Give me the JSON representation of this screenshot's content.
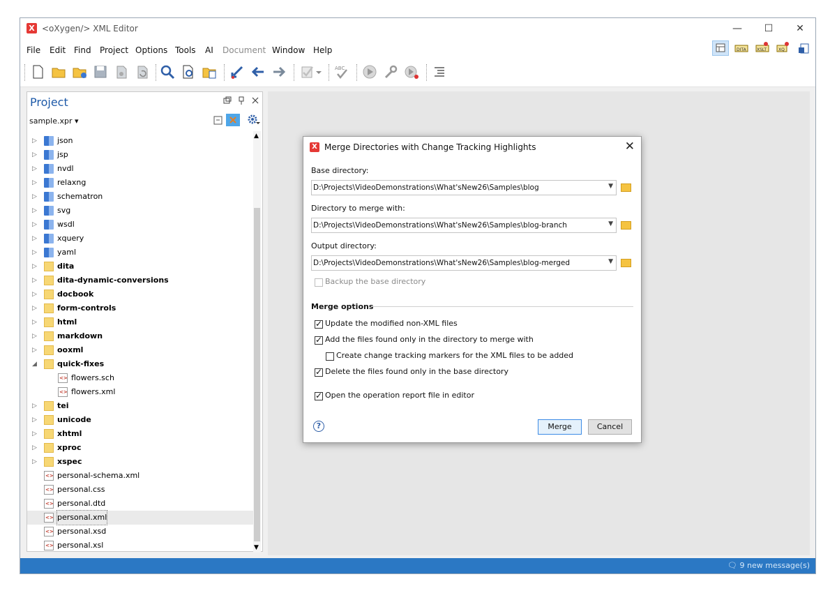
{
  "window": {
    "title": "<oXygen/> XML Editor",
    "minimize": "—",
    "maximize": "☐",
    "close": "✕"
  },
  "menubar": [
    "File",
    "Edit",
    "Find",
    "Project",
    "Options",
    "Tools",
    "AI",
    "Document",
    "Window",
    "Help"
  ],
  "menubar_disabled": "Document",
  "perspectives": [
    "editor-perspective-icon",
    "dita-perspective-icon",
    "xslt-debugger-icon",
    "xquery-debugger-icon",
    "database-perspective-icon"
  ],
  "perspective_labels": {
    "dita": "DITA",
    "xslt": "XSLT",
    "xq": "XQ"
  },
  "toolbar_icons": [
    "new-file-icon",
    "open-folder-icon",
    "open-url-icon",
    "save-icon",
    "save-all-icon",
    "reload-icon",
    "find-icon",
    "find-in-files-icon",
    "open-find-resource-icon",
    "back-to-position-icon",
    "back-icon",
    "forward-icon",
    "validate-icon",
    "check-spelling-icon",
    "apply-transformation-icon",
    "configure-transformation-icon",
    "debug-transformation-icon",
    "format-indent-icon"
  ],
  "project": {
    "title": "Project",
    "file": "sample.xpr",
    "items": [
      {
        "label": "json",
        "type": "lib",
        "bold": false,
        "twisty": "▷",
        "depth": 0
      },
      {
        "label": "jsp",
        "type": "lib",
        "bold": false,
        "twisty": "▷",
        "depth": 0
      },
      {
        "label": "nvdl",
        "type": "lib",
        "bold": false,
        "twisty": "▷",
        "depth": 0
      },
      {
        "label": "relaxng",
        "type": "lib",
        "bold": false,
        "twisty": "▷",
        "depth": 0
      },
      {
        "label": "schematron",
        "type": "lib",
        "bold": false,
        "twisty": "▷",
        "depth": 0
      },
      {
        "label": "svg",
        "type": "lib",
        "bold": false,
        "twisty": "▷",
        "depth": 0
      },
      {
        "label": "wsdl",
        "type": "lib",
        "bold": false,
        "twisty": "▷",
        "depth": 0
      },
      {
        "label": "xquery",
        "type": "lib",
        "bold": false,
        "twisty": "▷",
        "depth": 0
      },
      {
        "label": "yaml",
        "type": "lib",
        "bold": false,
        "twisty": "▷",
        "depth": 0
      },
      {
        "label": "dita",
        "type": "folder",
        "bold": true,
        "twisty": "▷",
        "depth": 0
      },
      {
        "label": "dita-dynamic-conversions",
        "type": "folder",
        "bold": true,
        "twisty": "▷",
        "depth": 0
      },
      {
        "label": "docbook",
        "type": "folder",
        "bold": true,
        "twisty": "▷",
        "depth": 0
      },
      {
        "label": "form-controls",
        "type": "folder",
        "bold": true,
        "twisty": "▷",
        "depth": 0
      },
      {
        "label": "html",
        "type": "folder",
        "bold": true,
        "twisty": "▷",
        "depth": 0
      },
      {
        "label": "markdown",
        "type": "folder",
        "bold": true,
        "twisty": "▷",
        "depth": 0
      },
      {
        "label": "ooxml",
        "type": "folder",
        "bold": true,
        "twisty": "▷",
        "depth": 0
      },
      {
        "label": "quick-fixes",
        "type": "folder",
        "bold": true,
        "twisty": "◢",
        "depth": 0
      },
      {
        "label": "flowers.sch",
        "type": "file",
        "bold": false,
        "twisty": "",
        "depth": 1
      },
      {
        "label": "flowers.xml",
        "type": "file",
        "bold": false,
        "twisty": "",
        "depth": 1
      },
      {
        "label": "tei",
        "type": "folder",
        "bold": true,
        "twisty": "▷",
        "depth": 0
      },
      {
        "label": "unicode",
        "type": "folder",
        "bold": true,
        "twisty": "▷",
        "depth": 0
      },
      {
        "label": "xhtml",
        "type": "folder",
        "bold": true,
        "twisty": "▷",
        "depth": 0
      },
      {
        "label": "xproc",
        "type": "folder",
        "bold": true,
        "twisty": "▷",
        "depth": 0
      },
      {
        "label": "xspec",
        "type": "folder",
        "bold": true,
        "twisty": "▷",
        "depth": 0
      },
      {
        "label": "personal-schema.xml",
        "type": "file",
        "bold": false,
        "twisty": "",
        "depth": 0
      },
      {
        "label": "personal.css",
        "type": "file",
        "bold": false,
        "twisty": "",
        "depth": 0
      },
      {
        "label": "personal.dtd",
        "type": "file",
        "bold": false,
        "twisty": "",
        "depth": 0
      },
      {
        "label": "personal.xml",
        "type": "file",
        "bold": false,
        "twisty": "",
        "depth": 0,
        "selected": true
      },
      {
        "label": "personal.xsd",
        "type": "file",
        "bold": false,
        "twisty": "",
        "depth": 0
      },
      {
        "label": "personal.xsl",
        "type": "file",
        "bold": false,
        "twisty": "",
        "depth": 0
      }
    ]
  },
  "dialog": {
    "title": "Merge Directories with Change Tracking Highlights",
    "base_label": "Base directory:",
    "base_value": "D:\\Projects\\VideoDemonstrations\\What'sNew26\\Samples\\blog",
    "merge_label": "Directory to merge with:",
    "merge_value": "D:\\Projects\\VideoDemonstrations\\What'sNew26\\Samples\\blog-branch",
    "output_label": "Output directory:",
    "output_value": "D:\\Projects\\VideoDemonstrations\\What'sNew26\\Samples\\blog-merged",
    "backup_label": "Backup the base directory",
    "section_title": "Merge options",
    "opt_update": "Update the modified non-XML files",
    "opt_add": "Add the files found only in the directory to merge with",
    "opt_markers": "Create change tracking markers for the XML files to be added",
    "opt_delete": "Delete the files found only in the base directory",
    "opt_report": "Open the operation report file in editor",
    "help": "?",
    "merge_button": "Merge",
    "cancel_button": "Cancel"
  },
  "status": {
    "messages": "9 new message(s)"
  },
  "colors": {
    "accent": "#2b78c4",
    "title_blue": "#1e5aa8",
    "logo_red": "#e53935",
    "folder": "#f7d774"
  }
}
